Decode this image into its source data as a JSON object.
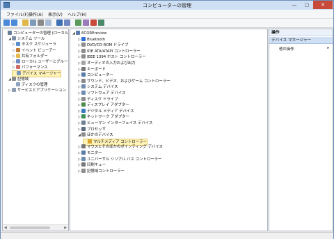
{
  "window": {
    "title": "コンピューターの管理",
    "controls": [
      "—",
      "▢",
      "✕"
    ]
  },
  "menu": [
    "ファイル(F)",
    "操作(A)",
    "表示(V)",
    "ヘルプ(H)"
  ],
  "left_tree": [
    {
      "label": "コンピューターの管理 (ローカル)",
      "level": 0,
      "expander": "",
      "icon": "computer-manage-icon",
      "color": "#6a7f99"
    },
    {
      "label": "システム ツール",
      "level": 1,
      "expander": "◢",
      "icon": "tools-icon",
      "color": "#7d8fa6"
    },
    {
      "label": "タスク スケジューラ",
      "level": 2,
      "expander": "▷",
      "icon": "clock-icon",
      "color": "#5b8fc9"
    },
    {
      "label": "イベント ビューアー",
      "level": 2,
      "expander": "▷",
      "icon": "event-viewer-icon",
      "color": "#c47a35"
    },
    {
      "label": "共有フォルダー",
      "level": 2,
      "expander": "▷",
      "icon": "shared-folder-icon",
      "color": "#e2b94a"
    },
    {
      "label": "ローカル ユーザーとグループ",
      "level": 2,
      "expander": "▷",
      "icon": "users-icon",
      "color": "#6f87c0"
    },
    {
      "label": "パフォーマンス",
      "level": 2,
      "expander": "▷",
      "icon": "performance-icon",
      "color": "#d06a6a"
    },
    {
      "label": "デバイス マネージャー",
      "level": 2,
      "expander": "",
      "icon": "device-manager-icon",
      "color": "#7d9ab8",
      "selected": true
    },
    {
      "label": "記憶域",
      "level": 1,
      "expander": "◢",
      "icon": "storage-icon",
      "color": "#8a8a8a"
    },
    {
      "label": "ディスクの管理",
      "level": 2,
      "expander": "",
      "icon": "disk-icon",
      "color": "#8aa3bf"
    },
    {
      "label": "サービスとアプリケーション",
      "level": 1,
      "expander": "▷",
      "icon": "services-icon",
      "color": "#8a9db4"
    }
  ],
  "device_tree": [
    {
      "label": "6COREreview",
      "level": 0,
      "expander": "◢",
      "icon": "computer-icon",
      "color": "#5a7ca8"
    },
    {
      "label": "Bluetooth",
      "level": 1,
      "expander": "▷",
      "icon": "bluetooth-icon",
      "color": "#2f6fd6"
    },
    {
      "label": "DVD/CD-ROM ドライブ",
      "level": 1,
      "expander": "▷",
      "icon": "dvd-drive-icon",
      "color": "#8c8c8c"
    },
    {
      "label": "IDE ATA/ATAPI コントローラー",
      "level": 1,
      "expander": "▷",
      "icon": "ide-controller-icon",
      "color": "#8c8c8c"
    },
    {
      "label": "IEEE 1394 ホスト コントローラー",
      "level": 1,
      "expander": "▷",
      "icon": "ieee1394-icon",
      "color": "#8c8c8c"
    },
    {
      "label": "オーディオの入力および出力",
      "level": 1,
      "expander": "▷",
      "icon": "audio-icon",
      "color": "#a3a3a3"
    },
    {
      "label": "キーボード",
      "level": 1,
      "expander": "▷",
      "icon": "keyboard-icon",
      "color": "#777777"
    },
    {
      "label": "コンピューター",
      "level": 1,
      "expander": "▷",
      "icon": "computer-icon",
      "color": "#5a7ca8"
    },
    {
      "label": "サウンド、ビデオ、およびゲーム コントローラー",
      "level": 1,
      "expander": "▷",
      "icon": "sound-icon",
      "color": "#8a8a8a"
    },
    {
      "label": "システム デバイス",
      "level": 1,
      "expander": "▷",
      "icon": "system-device-icon",
      "color": "#6e8cb0"
    },
    {
      "label": "ソフトウェア デバイス",
      "level": 1,
      "expander": "▷",
      "icon": "software-device-icon",
      "color": "#6e8cb0"
    },
    {
      "label": "ディスク ドライブ",
      "level": 1,
      "expander": "▷",
      "icon": "disk-drive-icon",
      "color": "#8c8c8c"
    },
    {
      "label": "ディスプレイ アダプター",
      "level": 1,
      "expander": "▷",
      "icon": "display-adapter-icon",
      "color": "#4f8a4f"
    },
    {
      "label": "デジタル メディア デバイス",
      "level": 1,
      "expander": "▷",
      "icon": "media-device-icon",
      "color": "#3c7ac0"
    },
    {
      "label": "ネットワーク アダプター",
      "level": 1,
      "expander": "▷",
      "icon": "network-adapter-icon",
      "color": "#3a8f5b"
    },
    {
      "label": "ヒューマン インターフェイス デバイス",
      "level": 1,
      "expander": "▷",
      "icon": "hid-icon",
      "color": "#6f7f94"
    },
    {
      "label": "プロセッサ",
      "level": 1,
      "expander": "▷",
      "icon": "processor-icon",
      "color": "#5e6e80"
    },
    {
      "label": "ほかのデバイス",
      "level": 1,
      "expander": "◢",
      "icon": "other-devices-icon",
      "color": "#8c8c8c"
    },
    {
      "label": "マルチメディア コントローラー",
      "level": 2,
      "expander": "",
      "icon": "warning-icon",
      "color": "#d9a730",
      "selected": true
    },
    {
      "label": "マウスとそのほかのポインティング デバイス",
      "level": 1,
      "expander": "▷",
      "icon": "mouse-icon",
      "color": "#777777"
    },
    {
      "label": "モニター",
      "level": 1,
      "expander": "▷",
      "icon": "monitor-icon",
      "color": "#5a7ca8"
    },
    {
      "label": "ユニバーサル シリアル バス コントローラー",
      "level": 1,
      "expander": "▷",
      "icon": "usb-icon",
      "color": "#6e8cb0"
    },
    {
      "label": "印刷キュー",
      "level": 1,
      "expander": "▷",
      "icon": "printer-icon",
      "color": "#777777"
    },
    {
      "label": "記憶域コントローラー",
      "level": 1,
      "expander": "▷",
      "icon": "storage-controller-icon",
      "color": "#8c8c8c"
    }
  ],
  "actions": {
    "header": "操作",
    "section": "デバイス マネージャー",
    "more": "他の操作",
    "arrow": "▸"
  }
}
